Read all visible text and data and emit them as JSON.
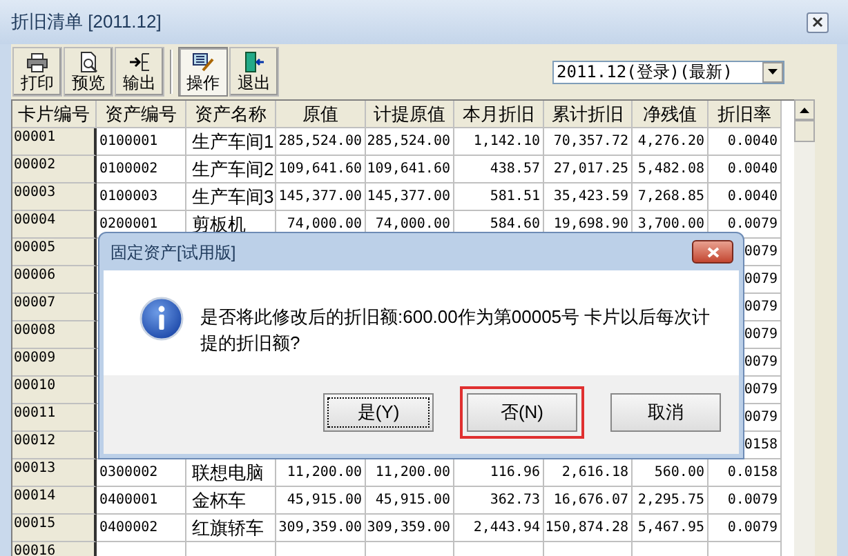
{
  "window": {
    "title": "折旧清单 [2011.12]"
  },
  "toolbar": [
    {
      "label": "打印",
      "kind": "print",
      "pressed": false
    },
    {
      "label": "预览",
      "kind": "preview",
      "pressed": false
    },
    {
      "label": "输出",
      "kind": "export",
      "pressed": false
    },
    {
      "label": "操作",
      "kind": "edit",
      "pressed": true
    },
    {
      "label": "退出",
      "kind": "exit",
      "pressed": false
    }
  ],
  "period_select": {
    "value": "2011.12(登录)(最新)"
  },
  "table": {
    "columns": [
      "卡片编号",
      "资产编号",
      "资产名称",
      "原值",
      "计提原值",
      "本月折旧",
      "累计折旧",
      "净残值",
      "折旧率"
    ],
    "rows": [
      {
        "cells": [
          "00001",
          "0100001",
          "生产车间1",
          "285,524.00",
          "285,524.00",
          "1,142.10",
          "70,357.72",
          "4,276.20",
          "0.0040"
        ]
      },
      {
        "cells": [
          "00002",
          "0100002",
          "生产车间2",
          "109,641.60",
          "109,641.60",
          "438.57",
          "27,017.25",
          "5,482.08",
          "0.0040"
        ]
      },
      {
        "cells": [
          "00003",
          "0100003",
          "生产车间3",
          "145,377.00",
          "145,377.00",
          "581.51",
          "35,423.59",
          "7,268.85",
          "0.0040"
        ]
      },
      {
        "cells": [
          "00004",
          "0200001",
          "剪板机",
          "74,000.00",
          "74,000.00",
          "584.60",
          "19,698.90",
          "3,700.00",
          "0.0079"
        ]
      },
      {
        "card": "00005",
        "rate": "0079"
      },
      {
        "card": "00006",
        "rate": "0079"
      },
      {
        "card": "00007",
        "rate": "0079"
      },
      {
        "card": "00008",
        "rate": "0079"
      },
      {
        "card": "00009",
        "rate": "0079"
      },
      {
        "card": "00010",
        "rate": "0079"
      },
      {
        "card": "00011",
        "rate": "0079"
      },
      {
        "card": "00012",
        "rate": "0158"
      },
      {
        "cells": [
          "00013",
          "0300002",
          "联想电脑",
          "11,200.00",
          "11,200.00",
          "116.96",
          "2,616.18",
          "560.00",
          "0.0158"
        ]
      },
      {
        "cells": [
          "00014",
          "0400001",
          "金杯车",
          "45,915.00",
          "45,915.00",
          "362.73",
          "16,676.07",
          "2,295.75",
          "0.0079"
        ]
      },
      {
        "cells": [
          "00015",
          "0400002",
          "红旗轿车",
          "309,359.00",
          "309,359.00",
          "2,443.94",
          "150,874.28",
          "5,467.95",
          "0.0079"
        ]
      },
      {
        "card": "00016"
      }
    ]
  },
  "dialog": {
    "title": "固定资产[试用版]",
    "message": "是否将此修改后的折旧额:600.00作为第00005号 卡片以后每次计提的折旧额?",
    "buttons": [
      {
        "label": "是(Y)",
        "focused": true,
        "highlighted": false
      },
      {
        "label": "否(N)",
        "focused": false,
        "highlighted": true
      },
      {
        "label": "取消",
        "focused": false,
        "highlighted": false
      }
    ]
  }
}
